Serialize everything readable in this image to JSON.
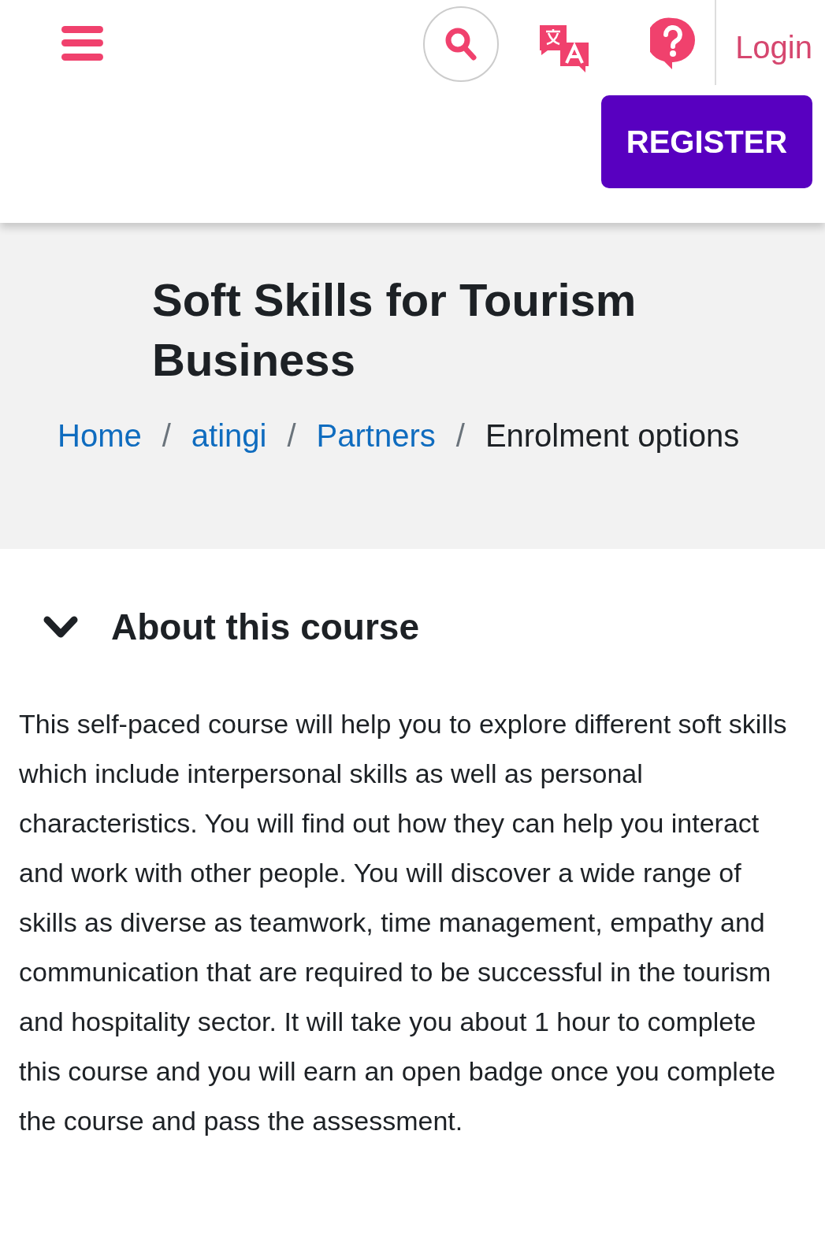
{
  "header": {
    "login": "Login",
    "register": "REGISTER"
  },
  "page_title": "Soft Skills for Tourism Business",
  "breadcrumb": [
    {
      "label": "Home",
      "kind": "link"
    },
    {
      "label": "/",
      "kind": "separator"
    },
    {
      "label": "atingi",
      "kind": "link"
    },
    {
      "label": "/",
      "kind": "separator"
    },
    {
      "label": "Partners",
      "kind": "link"
    },
    {
      "label": "/",
      "kind": "separator"
    },
    {
      "label": "Enrolment options",
      "kind": "current"
    }
  ],
  "section": {
    "title": "About this course",
    "expanded": true,
    "text": "This self-paced course will help you to explore different soft skills which include interpersonal skills as well as personal characteristics. You will find out how they can help you interact and work with other people. You will discover a wide range of skills as diverse as teamwork, time management, empathy and communication that are required to be successful in the tourism and hospitality sector. It will take you about 1 hour to complete this course and you will earn an open badge once you complete the course and pass the assessment."
  }
}
